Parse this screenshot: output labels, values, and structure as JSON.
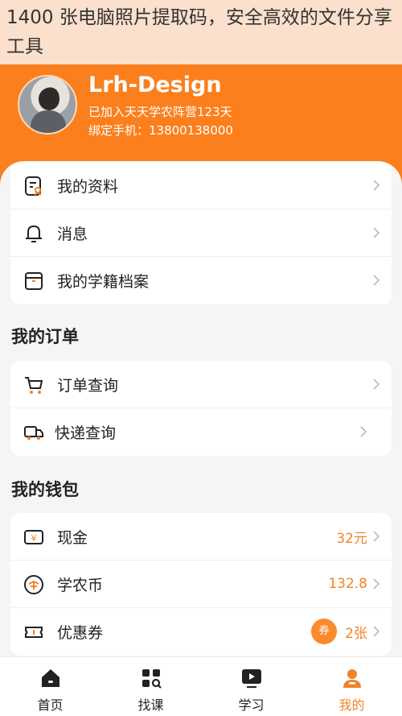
{
  "overlay": {
    "title": "1400 张电脑照片提取码，安全高效的文件分享工具"
  },
  "profile": {
    "name": "Lrh-Design",
    "days": "已加入天天学农阵营123天",
    "phone": "绑定手机：13800138000"
  },
  "menu1": [
    {
      "label": "我的资料",
      "icon": "profile-doc-icon"
    },
    {
      "label": "消息",
      "icon": "bell-icon"
    },
    {
      "label": "我的学籍档案",
      "icon": "archive-box-icon"
    }
  ],
  "orders": {
    "title": "我的订单",
    "items": [
      {
        "label": "订单查询",
        "icon": "cart-icon"
      },
      {
        "label": "快递查询",
        "icon": "truck-icon"
      }
    ]
  },
  "wallet": {
    "title": "我的钱包",
    "items": [
      {
        "label": "现金",
        "value": "32元",
        "icon": "yuan-wallet-icon"
      },
      {
        "label": "学农币",
        "value": "132.8",
        "icon": "coin-icon"
      },
      {
        "label": "优惠券",
        "value": "2张",
        "badge": "券",
        "icon": "ticket-icon"
      }
    ]
  },
  "tabs": [
    {
      "label": "首页",
      "icon": "home-icon"
    },
    {
      "label": "找课",
      "icon": "grid-search-icon"
    },
    {
      "label": "学习",
      "icon": "play-screen-icon"
    },
    {
      "label": "我的",
      "icon": "user-icon",
      "active": true
    }
  ],
  "colors": {
    "accent": "#fb7f1d",
    "value": "#f08428",
    "overlay": "#fbe0cd"
  }
}
